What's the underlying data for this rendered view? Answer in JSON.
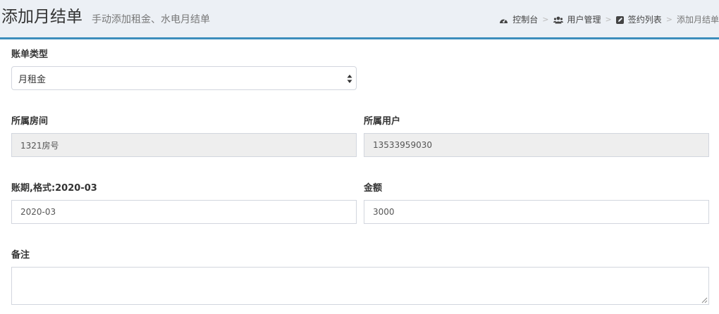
{
  "header": {
    "title": "添加月结单",
    "subtitle": "手动添加租金、水电月结单"
  },
  "breadcrumb": {
    "items": [
      {
        "label": "控制台",
        "icon": "dashboard-icon"
      },
      {
        "label": "用户管理",
        "icon": "users-icon"
      },
      {
        "label": "签约列表",
        "icon": "edit-icon"
      },
      {
        "label": "添加月结单"
      }
    ],
    "separator": ">"
  },
  "form": {
    "bill_type": {
      "label": "账单类型",
      "value": "月租金"
    },
    "room": {
      "label": "所属房间",
      "value": "1321房号"
    },
    "user": {
      "label": "所属用户",
      "value": "13533959030"
    },
    "period": {
      "label": "账期,格式:2020-03",
      "value": "2020-03"
    },
    "amount": {
      "label": "金额",
      "value": "3000"
    },
    "remark": {
      "label": "备注",
      "value": ""
    }
  },
  "colors": {
    "accent": "#3c8dbc",
    "background": "#ecf0f5",
    "readonly": "#eeeeee",
    "border": "#d2d6de"
  }
}
